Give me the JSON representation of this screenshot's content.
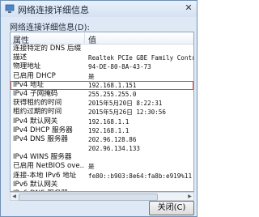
{
  "window": {
    "title": "网络连接详细信息",
    "close_glyph": "✕"
  },
  "details_label": "网络连接详细信息(D):",
  "table": {
    "columns": [
      "属性",
      "值"
    ],
    "rows": [
      {
        "property": "连接特定的 DNS 后缀",
        "value": ""
      },
      {
        "property": "描述",
        "value": "Realtek PCIe GBE Family Contro"
      },
      {
        "property": "物理地址",
        "value": "94-DE-80-8A-43-73"
      },
      {
        "property": "已启用 DHCP",
        "value": "是"
      },
      {
        "property": "IPv4 地址",
        "value": "192.168.1.151"
      },
      {
        "property": "IPv4 子网掩码",
        "value": "255.255.255.0"
      },
      {
        "property": "获得租约的时间",
        "value": "2015年5月20日 8:22:31"
      },
      {
        "property": "租约过期的时间",
        "value": "2015年5月26日 12:30:56"
      },
      {
        "property": "IPv4 默认网关",
        "value": "192.168.1.1"
      },
      {
        "property": "IPv4 DHCP 服务器",
        "value": "192.168.1.1"
      },
      {
        "property": "IPv4 DNS 服务器",
        "value": "202.96.128.86"
      },
      {
        "property": "",
        "value": "202.96.134.133"
      },
      {
        "property": "IPv4 WINS 服务器",
        "value": ""
      },
      {
        "property": "已启用 NetBIOS ove...",
        "value": "是"
      },
      {
        "property": "连接-本地 IPv6 地址",
        "value": "fe80::b903:8e64:fa8b:e919%11"
      },
      {
        "property": "IPv6 默认网关",
        "value": ""
      },
      {
        "property": "IPv6 DNS 服务器",
        "value": ""
      }
    ],
    "selected_index": 4
  },
  "buttons": {
    "close": "关闭(C)"
  },
  "colors": {
    "selection_outline": "#d24b3c",
    "title_bar": "#d4e2f3"
  }
}
